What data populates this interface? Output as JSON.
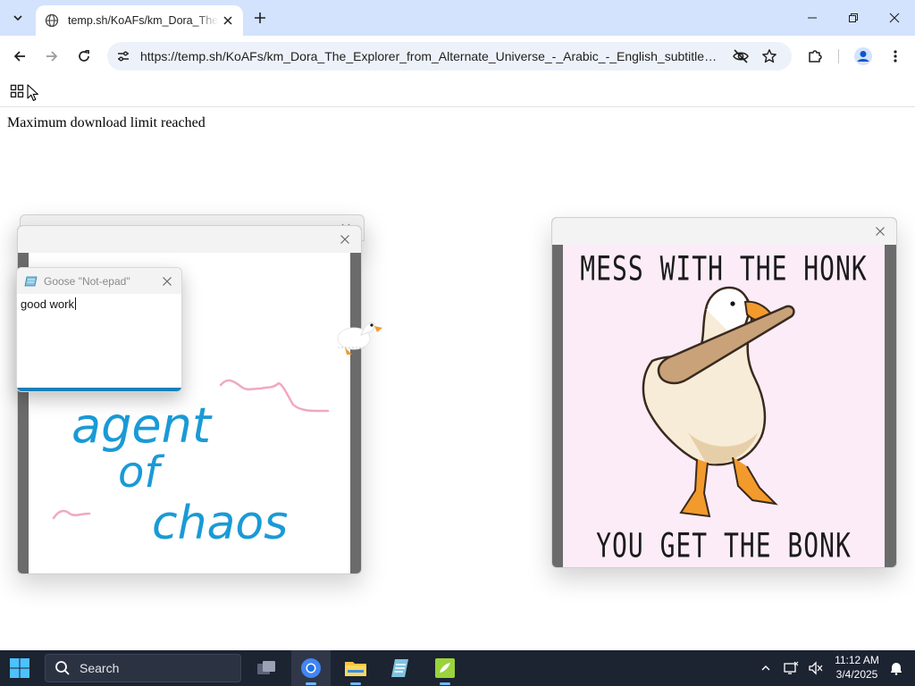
{
  "browser": {
    "tab": {
      "title": "temp.sh/KoAFs/km_Dora_The_Explorer"
    },
    "address_bar": {
      "url": "https://temp.sh/KoAFs/km_Dora_The_Explorer_from_Alternate_Universe_-_Arabic_-_English_subtitles_72..."
    }
  },
  "page": {
    "message": "Maximum download limit reached"
  },
  "notepad": {
    "title": "Goose \"Not-epad\"",
    "text": "good work"
  },
  "drawing": {
    "words": [
      "agent",
      "of",
      "chaos"
    ],
    "ink_color": "#1a9ad6",
    "scribble_color": "#f0a8c4"
  },
  "meme": {
    "top_text": "MESS WITH THE HONK",
    "bottom_text": "YOU GET THE BONK",
    "background": "#fcecf8"
  },
  "taskbar": {
    "search_label": "Search",
    "clock": {
      "time": "11:12 AM",
      "date": "3/4/2025"
    }
  },
  "colors": {
    "tabstrip": "#d3e3fd",
    "omnibox": "#edf2fa",
    "taskbar": "#1c2331",
    "goose_orange": "#f39a2c"
  }
}
